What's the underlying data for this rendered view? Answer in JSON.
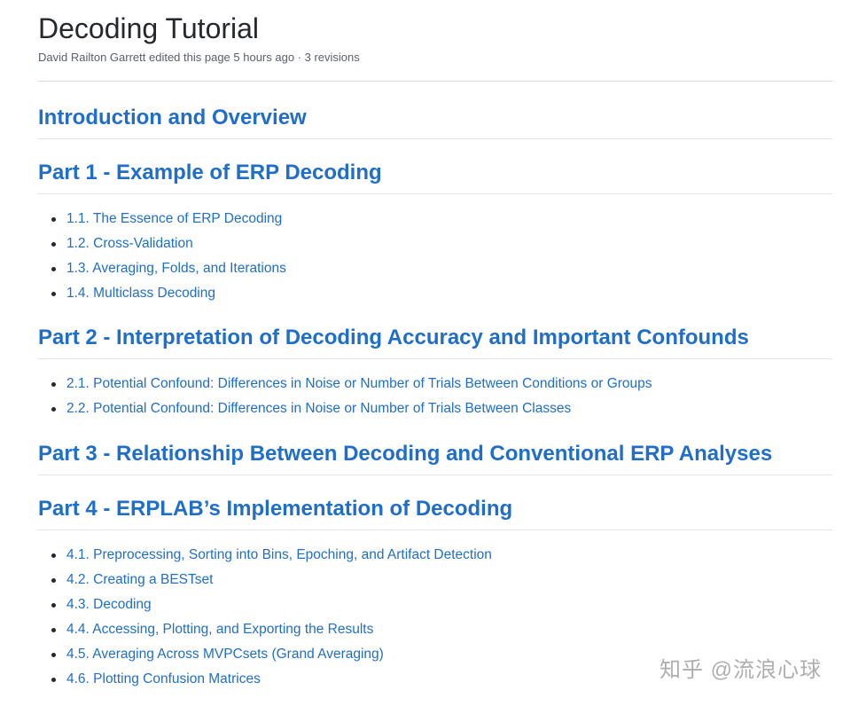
{
  "header": {
    "title": "Decoding Tutorial",
    "meta": "David Railton Garrett edited this page 5 hours ago · 3 revisions"
  },
  "sections": [
    {
      "heading": "Introduction and Overview",
      "items": []
    },
    {
      "heading": "Part 1 - Example of ERP Decoding",
      "items": [
        "1.1. The Essence of ERP Decoding",
        "1.2. Cross-Validation",
        "1.3. Averaging, Folds, and Iterations",
        "1.4. Multiclass Decoding"
      ]
    },
    {
      "heading": "Part 2 - Interpretation of Decoding Accuracy and Important Confounds",
      "items": [
        "2.1. Potential Confound: Differences in Noise or Number of Trials Between Conditions or Groups",
        "2.2. Potential Confound: Differences in Noise or Number of Trials Between Classes"
      ]
    },
    {
      "heading": "Part 3 - Relationship Between Decoding and Conventional ERP Analyses",
      "items": []
    },
    {
      "heading": "Part 4 - ERPLAB’s Implementation of Decoding",
      "items": [
        "4.1. Preprocessing, Sorting into Bins, Epoching, and Artifact Detection",
        "4.2. Creating a BESTset",
        "4.3. Decoding",
        "4.4. Accessing, Plotting, and Exporting the Results",
        "4.5. Averaging Across MVPCsets (Grand Averaging)",
        "4.6. Plotting Confusion Matrices"
      ]
    }
  ],
  "watermark": "知乎 @流浪心球",
  "colors": {
    "link": "#1f6ec9",
    "text": "#24292e",
    "muted": "#586069"
  }
}
